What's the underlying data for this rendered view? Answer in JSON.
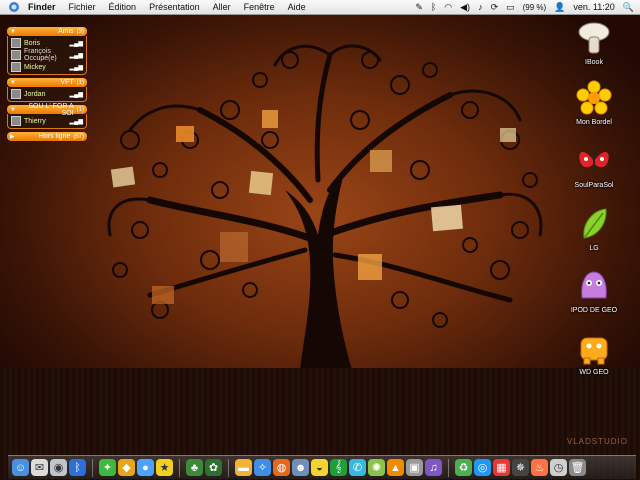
{
  "menubar": {
    "app_name": "Finder",
    "menus": [
      "Fichier",
      "Édition",
      "Présentation",
      "Aller",
      "Fenêtre",
      "Aide"
    ],
    "battery": "(99 %)",
    "clock": "ven. 11:20"
  },
  "buddy_list": {
    "groups": [
      {
        "name": "Amis",
        "count": "(3)",
        "buddies": [
          "Boris",
          "François Occupé(e)",
          "Mickey"
        ]
      },
      {
        "name": "VFT",
        "count": "(1)",
        "buddies": [
          "Jordan"
        ]
      },
      {
        "name": "SOU L' FOR A SOI",
        "count": "(1)",
        "buddies": [
          "Thierry"
        ]
      },
      {
        "name": "Hors ligne",
        "count": "(57)",
        "buddies": []
      }
    ]
  },
  "desktop_icons": [
    {
      "label": "IBook",
      "icon": "mushroom-icon"
    },
    {
      "label": "Mon Bordel",
      "icon": "flower-icon"
    },
    {
      "label": "SoulParaSol",
      "icon": "butterfly-icon"
    },
    {
      "label": "LG",
      "icon": "leaf-icon"
    },
    {
      "label": "IPOD DE GEO",
      "icon": "purple-creature-icon"
    },
    {
      "label": "WD GEO",
      "icon": "orange-creature-icon"
    }
  ],
  "dock": {
    "items": [
      "finder-icon",
      "mail-icon",
      "disk-icon",
      "bluetooth-icon",
      "app-green-icon",
      "app-orange-icon",
      "app-blue-icon",
      "app-yellow-icon",
      "tree-icon",
      "plant-icon",
      "folder-icon",
      "safari-icon",
      "firefox-icon",
      "user-icon",
      "duck-icon",
      "music-icon",
      "chat-icon",
      "compass-icon",
      "vlc-icon",
      "photo-icon",
      "itunes-icon",
      "recycle-icon",
      "globe-icon",
      "calendar-icon",
      "spider-icon",
      "torch-icon",
      "clock-icon",
      "trash-icon"
    ]
  },
  "watermark": "VLADSTUDIO",
  "colors": {
    "wallpaper_center": "#9a4516",
    "wallpaper_edge": "#220a03",
    "buddy_header": "#ea7a00",
    "buddy_name": "#e8ff9c"
  }
}
